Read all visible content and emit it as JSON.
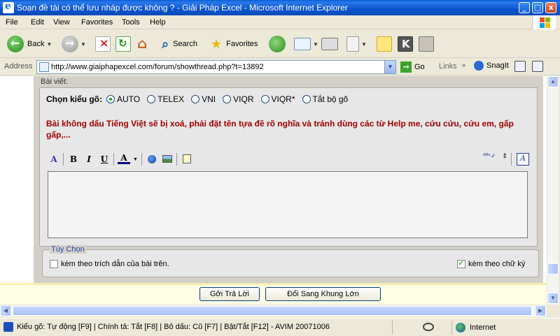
{
  "window": {
    "title": "Soạn đề tài có thể lưu nháp được không ? - Giải Pháp Excel - Microsoft Internet Explorer",
    "min": "_",
    "max": "□",
    "close": "x"
  },
  "menu": [
    "File",
    "Edit",
    "View",
    "Favorites",
    "Tools",
    "Help"
  ],
  "toolbar": {
    "back": "Back",
    "search": "Search",
    "favorites": "Favorites"
  },
  "address": {
    "label": "Address",
    "url": "http://www.giaiphapexcel.com/forum/showthread.php?t=13892",
    "go": "Go",
    "links": "Links",
    "snagit": "SnagIt"
  },
  "editor": {
    "bai_viet": "Bài viết:",
    "kieu_go_label": "Chọn kiểu gõ:",
    "input_methods": [
      {
        "label": "AUTO",
        "selected": true
      },
      {
        "label": "TELEX",
        "selected": false
      },
      {
        "label": "VNI",
        "selected": false
      },
      {
        "label": "VIQR",
        "selected": false
      },
      {
        "label": "VIQR*",
        "selected": false
      },
      {
        "label": "Tắt bộ gõ",
        "selected": false
      }
    ],
    "notice": "Bài không dấu Tiếng Việt sẽ bị xoá, phải đặt tên tựa đề rõ nghĩa và tránh dùng các từ Help me, cứu cứu, cứu em, gấp gấp,...",
    "format_buttons": {
      "bold": "B",
      "italic": "I",
      "underline": "U",
      "font_color": "A"
    },
    "textarea_value": ""
  },
  "options": {
    "legend": "Tùy Chọn",
    "quote": {
      "label": "kèm theo trích dẫn của bài trên.",
      "checked": false
    },
    "signature": {
      "label": "kèm theo chữ ký",
      "checked": true
    }
  },
  "buttons": {
    "reply": "Gởi Trả Lời",
    "switch": "Đổi Sang Khung Lớn"
  },
  "status": {
    "text": "Kiểu gõ: Tự động [F9] | Chính tả: Tắt [F8] | Bỏ dấu: Cũ [F7] | Bật/Tắt [F12] - AVIM 20071006",
    "zone": "Internet"
  },
  "colors": {
    "title_bar": "#0b54cf",
    "notice": "#a00000",
    "panel": "#d4d0c8",
    "accent_green": "#21a121"
  }
}
